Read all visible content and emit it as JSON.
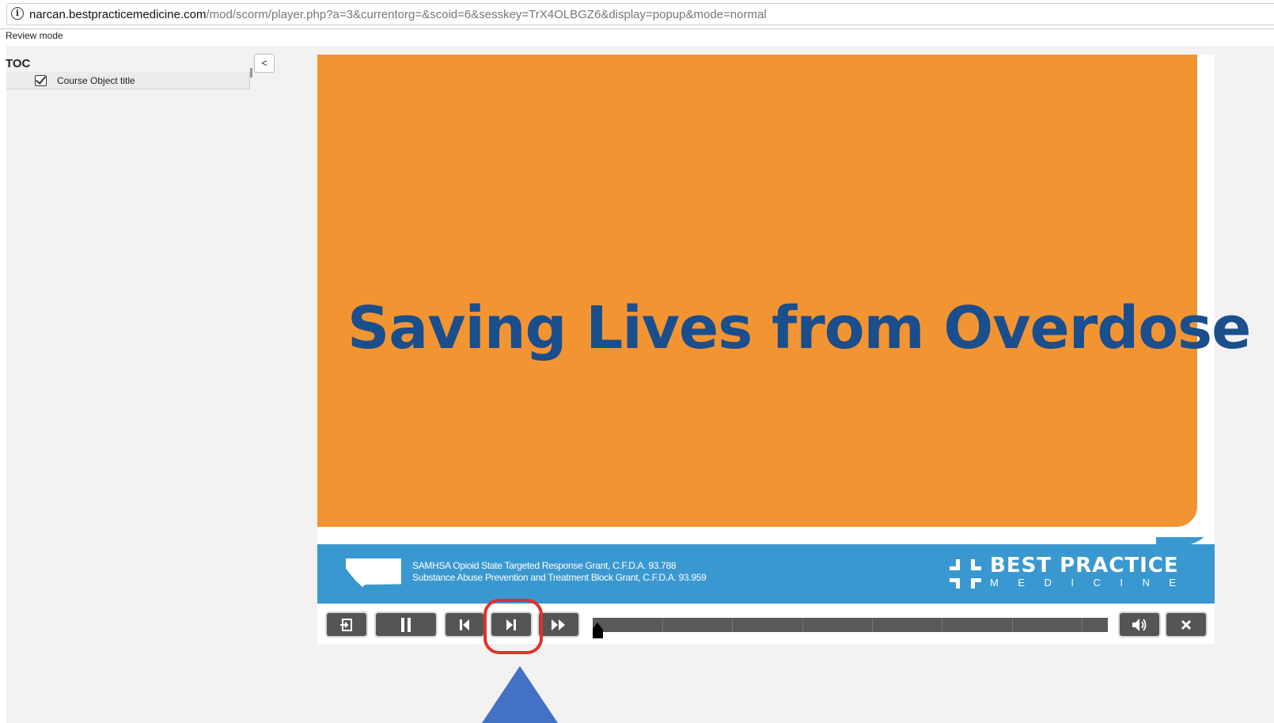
{
  "browser": {
    "url_host": "narcan.bestpracticemedicine.com",
    "url_path": "/mod/scorm/player.php?a=3&currentorg=&scoid=6&sesskey=TrX4OLBGZ6&display=popup&mode=normal"
  },
  "review_mode_label": "Review mode",
  "toc": {
    "title": "TOC",
    "collapse_label": "<",
    "items": [
      {
        "label": "Course Object title",
        "completed": true
      }
    ]
  },
  "slide": {
    "title": "Saving Lives from Overdose",
    "background_color": "#f39432",
    "title_color": "#1a4e8c",
    "footer": {
      "line1": "SAMHSA Opioid State Targeted Response Grant, C.F.D.A. 93.788",
      "line2": "Substance Abuse Prevention and Treatment Block Grant, C.F.D.A. 93.959",
      "brand_title": "BEST PRACTICE",
      "brand_sub": "MEDICINE",
      "background_color": "#3a98d0"
    }
  },
  "controls": {
    "buttons": [
      {
        "name": "exit-button",
        "icon": "exit-icon"
      },
      {
        "name": "pause-button",
        "icon": "pause-icon"
      },
      {
        "name": "previous-slide-button",
        "icon": "skip-back-icon"
      },
      {
        "name": "next-slide-button",
        "icon": "skip-forward-icon",
        "highlighted": true
      },
      {
        "name": "fast-forward-button",
        "icon": "fast-forward-icon"
      },
      {
        "name": "volume-button",
        "icon": "volume-icon"
      },
      {
        "name": "close-button",
        "icon": "close-icon"
      }
    ],
    "progress_fraction": 0.0
  },
  "annotation": {
    "highlight_color": "#e0312b",
    "arrow_color": "#4472c4"
  }
}
